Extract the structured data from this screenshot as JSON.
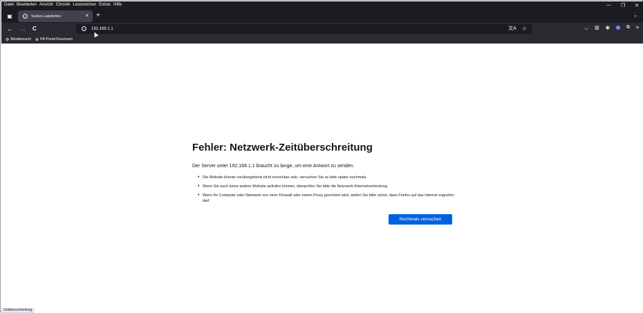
{
  "menubar": {
    "items": [
      "Datei",
      "Bearbeiten",
      "Ansicht",
      "Chronik",
      "Lesezeichen",
      "Extras",
      "Hilfe"
    ]
  },
  "window_controls": {
    "minimize_icon": "minimize-icon",
    "restore_icon": "restore-icon",
    "close_icon": "close-icon"
  },
  "tab": {
    "title": "Seiten-Ladefehler",
    "close": "×"
  },
  "new_tab": "+",
  "nav": {
    "back": "←",
    "forward": "→",
    "reload": "C",
    "url": "192.168.1.1"
  },
  "bookmarks": [
    {
      "label": "Meistbesucht",
      "icon": "gear-icon"
    },
    {
      "label": "HR-Portal Rossmann",
      "icon": "globe-icon"
    }
  ],
  "error": {
    "title": "Fehler: Netzwerk-Zeitüberschreitung",
    "description": "Der Server unter 192.168.1.1 braucht zu lange, um eine Antwort zu senden.",
    "bullets": [
      "Die Website könnte vorübergehend nicht erreichbar sein, versuchen Sie es bitte später nochmals.",
      "Wenn Sie auch keine andere Website aufrufen können, überprüfen Sie bitte die Netzwerk-/Internetverbindung.",
      "Wenn Ihr Computer oder Netzwerk von einer Firewall oder einem Proxy geschützt wird, stellen Sie bitte sicher, dass Firefox auf das Internet zugreifen darf."
    ],
    "retry_label": "Nochmals versuchen"
  },
  "status": "Zeitüberschreitung",
  "colors": {
    "chrome_dark": "#1c1b22",
    "toolbar": "#2b2a33",
    "accent": "#0061e0"
  }
}
